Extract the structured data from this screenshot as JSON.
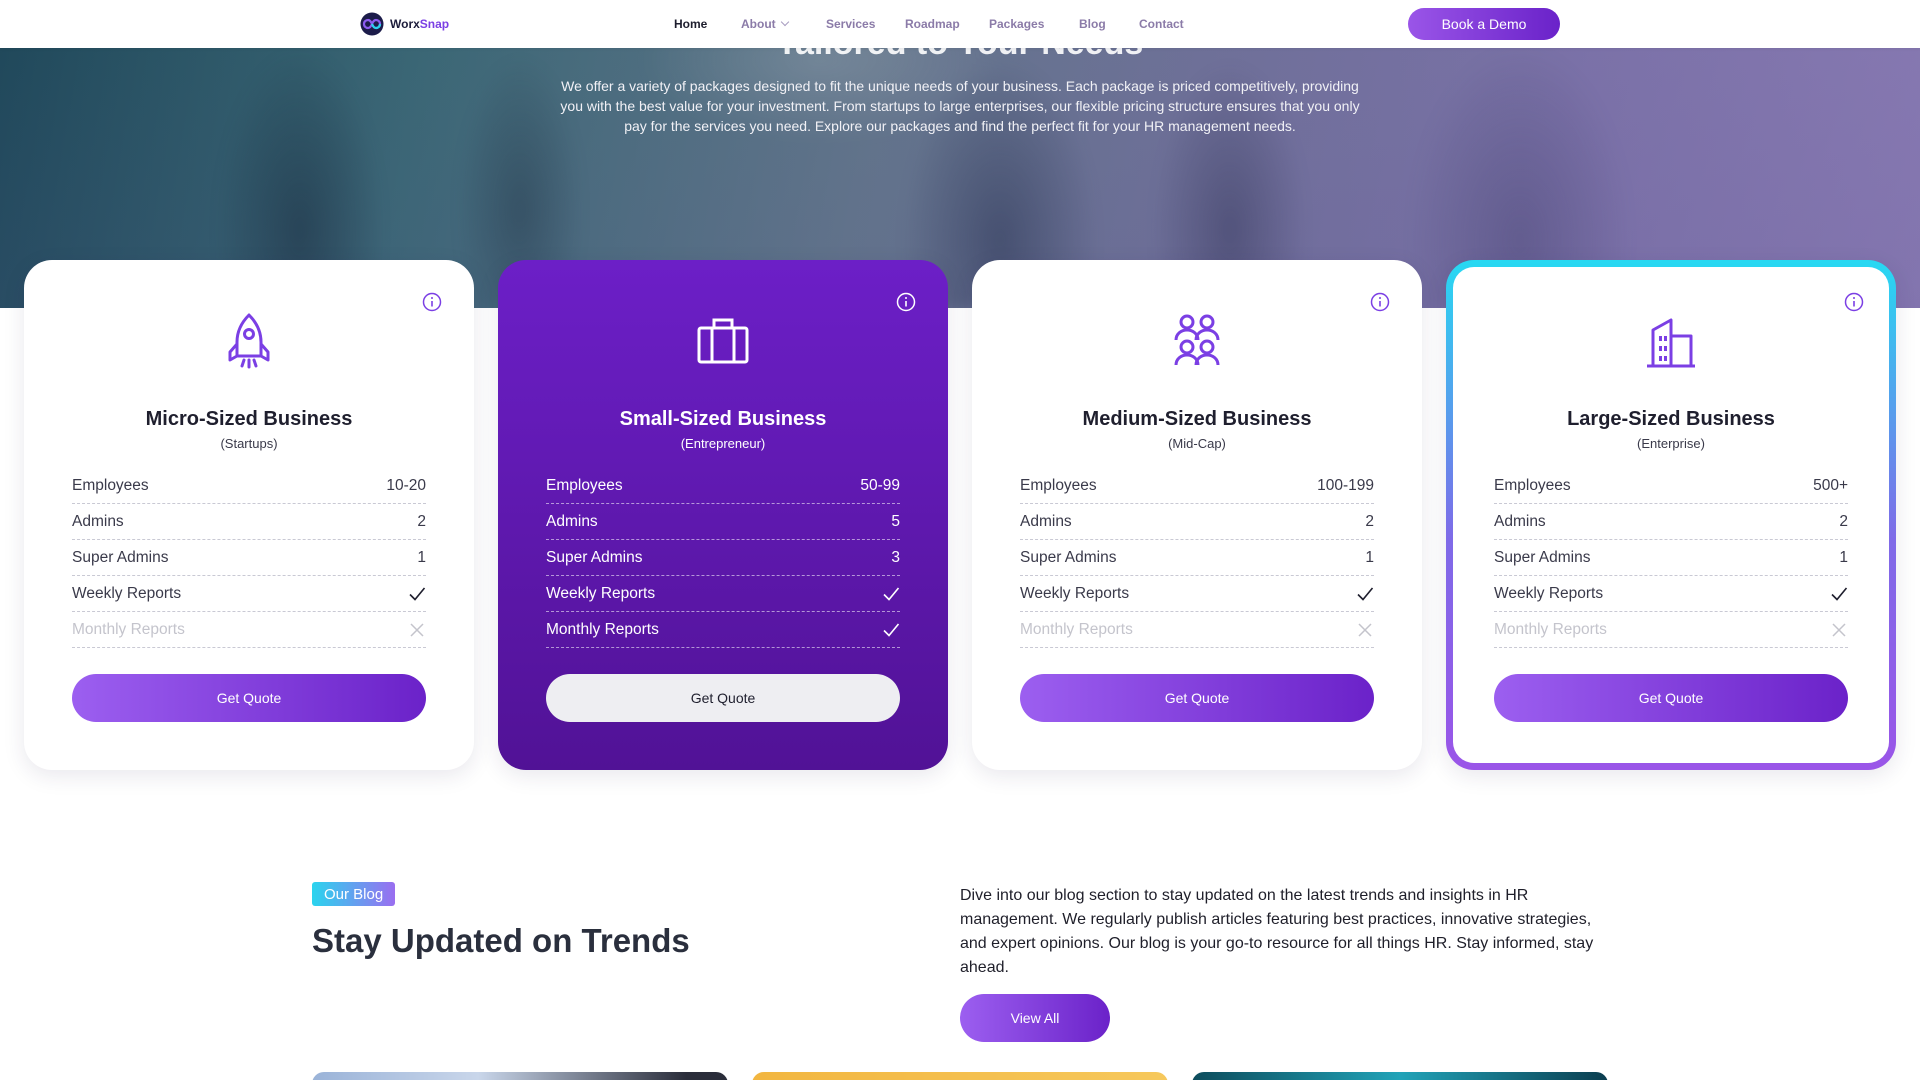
{
  "nav": {
    "logo": {
      "part1": "Worx",
      "part2": "Snap"
    },
    "links": [
      {
        "label": "Home",
        "active": true
      },
      {
        "label": "About",
        "dropdown": true
      },
      {
        "label": "Services"
      },
      {
        "label": "Roadmap"
      },
      {
        "label": "Packages"
      },
      {
        "label": "Blog"
      },
      {
        "label": "Contact"
      }
    ],
    "cta": "Book a Demo"
  },
  "hero": {
    "title": "Tailored to Your Needs",
    "description": "We offer a variety of packages designed to fit the unique needs of your business. Each package is priced competitively, providing you with the best value for your investment. From startups to large enterprises, our flexible pricing structure ensures that you only pay for the services you need. Explore our packages and find the perfect fit for your HR management needs."
  },
  "plans": [
    {
      "name": "Micro-Sized Business",
      "subtitle": "(Startups)",
      "icon": "rocket-icon",
      "features": [
        {
          "label": "Employees",
          "value": "10-20"
        },
        {
          "label": "Admins",
          "value": "2"
        },
        {
          "label": "Super Admins",
          "value": "1"
        },
        {
          "label": "Weekly Reports",
          "included": true
        },
        {
          "label": "Monthly Reports",
          "included": false
        }
      ],
      "button": "Get Quote"
    },
    {
      "name": "Small-Sized Business",
      "subtitle": "(Entrepreneur)",
      "icon": "briefcase-icon",
      "features": [
        {
          "label": "Employees",
          "value": "50-99"
        },
        {
          "label": "Admins",
          "value": "5"
        },
        {
          "label": "Super Admins",
          "value": "3"
        },
        {
          "label": "Weekly Reports",
          "included": true
        },
        {
          "label": "Monthly Reports",
          "included": true
        }
      ],
      "button": "Get Quote"
    },
    {
      "name": "Medium-Sized Business",
      "subtitle": "(Mid-Cap)",
      "icon": "team-icon",
      "features": [
        {
          "label": "Employees",
          "value": "100-199"
        },
        {
          "label": "Admins",
          "value": "2"
        },
        {
          "label": "Super Admins",
          "value": "1"
        },
        {
          "label": "Weekly Reports",
          "included": true
        },
        {
          "label": "Monthly Reports",
          "included": false
        }
      ],
      "button": "Get Quote"
    },
    {
      "name": "Large-Sized Business",
      "subtitle": "(Enterprise)",
      "icon": "building-icon",
      "features": [
        {
          "label": "Employees",
          "value": "500+"
        },
        {
          "label": "Admins",
          "value": "2"
        },
        {
          "label": "Super Admins",
          "value": "1"
        },
        {
          "label": "Weekly Reports",
          "included": true
        },
        {
          "label": "Monthly Reports",
          "included": false
        }
      ],
      "button": "Get Quote"
    }
  ],
  "blog": {
    "tag": "Our Blog",
    "title": "Stay Updated on Trends",
    "description": "Dive into our blog section to stay updated on the latest trends and insights in HR management. We regularly publish articles featuring best practices, innovative strategies, and expert opinions. Our blog is your go-to resource for all things HR. Stay informed, stay ahead.",
    "button": "View All"
  },
  "colors": {
    "accent": "#7b3fe4",
    "accent_dark": "#5a15a8",
    "highlight_border": "#27d9f2",
    "check": "#1f1f2e",
    "cross_disabled": "#c4c4cc"
  }
}
